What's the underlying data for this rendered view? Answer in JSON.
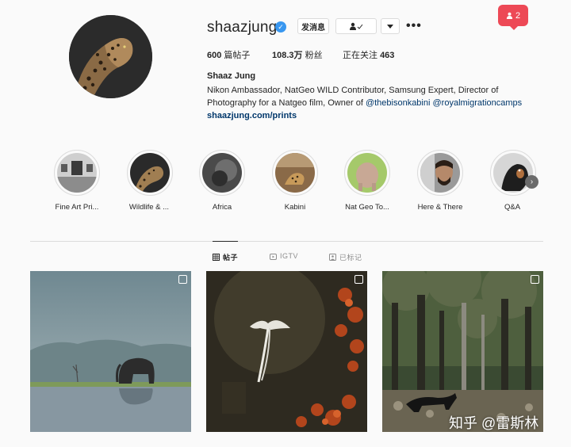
{
  "notifications": {
    "count": "2"
  },
  "profile": {
    "username": "shaazjung",
    "verified_mark": "✓",
    "message_button": "发消息",
    "more_label": "•••",
    "stats": {
      "posts": "600",
      "posts_label": "篇帖子",
      "followers": "108.3万",
      "followers_label": "粉丝",
      "following_label": "正在关注",
      "following": "463"
    },
    "full_name": "Shaaz Jung",
    "bio_line1": "Nikon Ambassador, NatGeo WILD Contributor, Samsung Expert, Director of",
    "bio_line2_prefix": "Photography for a Natgeo film, Owner of ",
    "bio_mention1": "@thebisonkabini",
    "bio_mention2": "@royalmigrationcamps",
    "website": "shaazjung.com/prints"
  },
  "highlights": [
    {
      "label": "Fine Art Pri..."
    },
    {
      "label": "Wildlife & ..."
    },
    {
      "label": "Africa"
    },
    {
      "label": "Kabini"
    },
    {
      "label": "Nat Geo To..."
    },
    {
      "label": "Here & There"
    },
    {
      "label": "Q&A"
    }
  ],
  "tabs": [
    {
      "label": "帖子"
    },
    {
      "label": "IGTV"
    },
    {
      "label": "已标记"
    }
  ],
  "watermark": "知乎 @雷斯林"
}
